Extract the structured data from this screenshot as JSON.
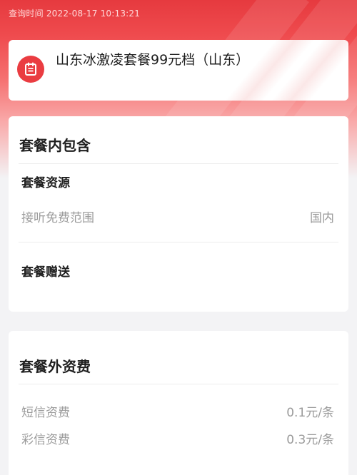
{
  "header": {
    "query_time": "查询时间 2022-08-17 10:13:21"
  },
  "plan": {
    "icon": "plan-document-icon",
    "title": "山东冰激凌套餐99元档（山东）"
  },
  "included": {
    "title": "套餐内包含",
    "resources_title": "套餐资源",
    "rows": [
      {
        "label": "接听免费范围",
        "value": "国内"
      }
    ],
    "gift_title": "套餐赠送"
  },
  "extra_fees": {
    "title": "套餐外资费",
    "rows": [
      {
        "label": "短信资费",
        "value": "0.1元/条"
      },
      {
        "label": "彩信资费",
        "value": "0.3元/条"
      }
    ]
  },
  "colors": {
    "brand_red": "#e63a3f",
    "background": "#f3f3f5",
    "muted_text": "#9b9b9b"
  }
}
